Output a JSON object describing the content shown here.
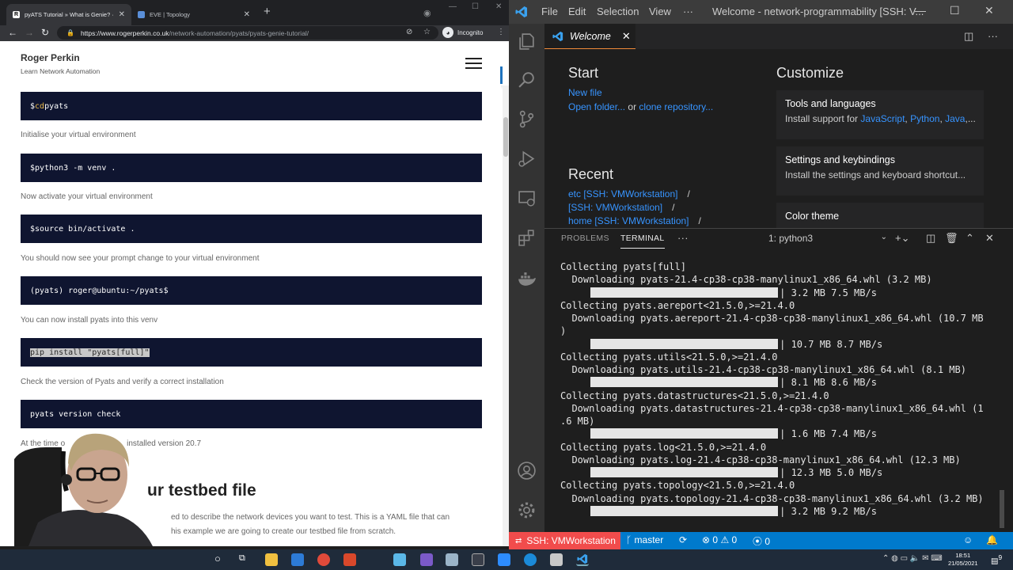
{
  "browser": {
    "tabs": [
      {
        "label": "pyATS Tutorial » What is Genie? ·",
        "favicon_color": "#ffffff"
      },
      {
        "label": "EVE | Topology",
        "favicon_color": "#5a8fd8"
      }
    ],
    "url_domain": "https://www.rogerperkin.co.uk",
    "url_path": "/network-automation/pyats/pyats-genie-tutorial/",
    "incognito_label": "Incognito"
  },
  "site": {
    "title": "Roger Perkin",
    "subtitle": "Learn Network Automation"
  },
  "article": {
    "blocks": [
      {
        "type": "code",
        "prefix": "$ ",
        "kw": "cd",
        "text": " pyats"
      },
      {
        "type": "text",
        "text": "Initialise your virtual environment"
      },
      {
        "type": "code",
        "prefix": "$ ",
        "kw": "",
        "text": "python3 -m venv ."
      },
      {
        "type": "text",
        "text": "Now activate your virtual environment"
      },
      {
        "type": "code",
        "prefix": "$ ",
        "kw": "",
        "text": "source bin/activate ."
      },
      {
        "type": "text",
        "text": "You should now see your prompt change to your virtual environment"
      },
      {
        "type": "code",
        "prefix": "",
        "kw": "",
        "text": "(pyats) roger@ubuntu:~/pyats$"
      },
      {
        "type": "text",
        "text": "You can now install pyats into this venv"
      },
      {
        "type": "code",
        "prefix": "",
        "kw": "",
        "text": "pip install \"pyats[full]\"",
        "selected": true
      },
      {
        "type": "text",
        "text": "Check the version of Pyats and verify a correct installation"
      },
      {
        "type": "code",
        "prefix": "",
        "kw": "",
        "text": "pyats version check"
      }
    ],
    "version_text_partial": "At the time o",
    "version_text_end": "installed version 20.7",
    "heading_partial": "ur testbed file",
    "para_line1": "ed to describe the network devices you want to test. This is a YAML file that can",
    "para_line2": "his example we are going to create our testbed file from scratch."
  },
  "vscode": {
    "menu": [
      "File",
      "Edit",
      "Selection",
      "View",
      "···"
    ],
    "window_title": "Welcome - network-programmability [SSH: V...",
    "editor_tab": "Welcome",
    "start": {
      "heading": "Start",
      "new_file": "New file",
      "open_folder": "Open folder...",
      "or": "or",
      "clone": "clone repository..."
    },
    "recent": {
      "heading": "Recent",
      "items": [
        {
          "label": "etc [SSH: VMWorkstation]",
          "sep": "/"
        },
        {
          "label": "[SSH: VMWorkstation]",
          "sep": "/"
        },
        {
          "label": "home [SSH: VMWorkstation]",
          "sep": "/"
        }
      ]
    },
    "customize": {
      "heading": "Customize",
      "cards": [
        {
          "title": "Tools and languages",
          "desc_prefix": "Install support for ",
          "links": [
            "JavaScript",
            "Python",
            "Java"
          ],
          "desc_suffix": ",..."
        },
        {
          "title": "Settings and keybindings",
          "desc_prefix": "Install the settings and keyboard shortcut...",
          "links": [],
          "desc_suffix": ""
        },
        {
          "title": "Color theme",
          "desc_prefix": "",
          "links": [],
          "desc_suffix": ""
        }
      ]
    },
    "panel": {
      "tabs": [
        "PROBLEMS",
        "TERMINAL",
        "···"
      ],
      "terminal_select": "1: python3"
    },
    "terminal_lines": [
      {
        "kind": "text",
        "text": "Collecting pyats[full]"
      },
      {
        "kind": "text",
        "text": "  Downloading pyats-21.4-cp38-cp38-manylinux1_x86_64.whl (3.2 MB)"
      },
      {
        "kind": "bar",
        "text": "3.2 MB 7.5 MB/s"
      },
      {
        "kind": "text",
        "text": "Collecting pyats.aereport<21.5.0,>=21.4.0"
      },
      {
        "kind": "text",
        "text": "  Downloading pyats.aereport-21.4-cp38-cp38-manylinux1_x86_64.whl (10.7 MB"
      },
      {
        "kind": "text",
        "text": ")"
      },
      {
        "kind": "bar",
        "text": "10.7 MB 8.7 MB/s"
      },
      {
        "kind": "text",
        "text": "Collecting pyats.utils<21.5.0,>=21.4.0"
      },
      {
        "kind": "text",
        "text": "  Downloading pyats.utils-21.4-cp38-cp38-manylinux1_x86_64.whl (8.1 MB)"
      },
      {
        "kind": "bar",
        "text": "8.1 MB 8.6 MB/s"
      },
      {
        "kind": "text",
        "text": "Collecting pyats.datastructures<21.5.0,>=21.4.0"
      },
      {
        "kind": "text",
        "text": "  Downloading pyats.datastructures-21.4-cp38-cp38-manylinux1_x86_64.whl (1"
      },
      {
        "kind": "text",
        "text": ".6 MB)"
      },
      {
        "kind": "bar",
        "text": "1.6 MB 7.4 MB/s"
      },
      {
        "kind": "text",
        "text": "Collecting pyats.log<21.5.0,>=21.4.0"
      },
      {
        "kind": "text",
        "text": "  Downloading pyats.log-21.4-cp38-cp38-manylinux1_x86_64.whl (12.3 MB)"
      },
      {
        "kind": "bar",
        "text": "12.3 MB 5.0 MB/s"
      },
      {
        "kind": "text",
        "text": "Collecting pyats.topology<21.5.0,>=21.4.0"
      },
      {
        "kind": "text",
        "text": "  Downloading pyats.topology-21.4-cp38-cp38-manylinux1_x86_64.whl (3.2 MB)"
      },
      {
        "kind": "bar",
        "text": "3.2 MB 9.2 MB/s"
      }
    ],
    "status": {
      "remote": "SSH: VMWorkstation",
      "branch": "master",
      "errors": "0",
      "warnings": "0",
      "ports": "0"
    },
    "colors": {
      "accent": "#007acc",
      "remote": "#f14c4c",
      "link": "#3794ff"
    }
  },
  "taskbar": {
    "time": "18:51",
    "date": "21/05/2021",
    "notif_count": "9"
  }
}
